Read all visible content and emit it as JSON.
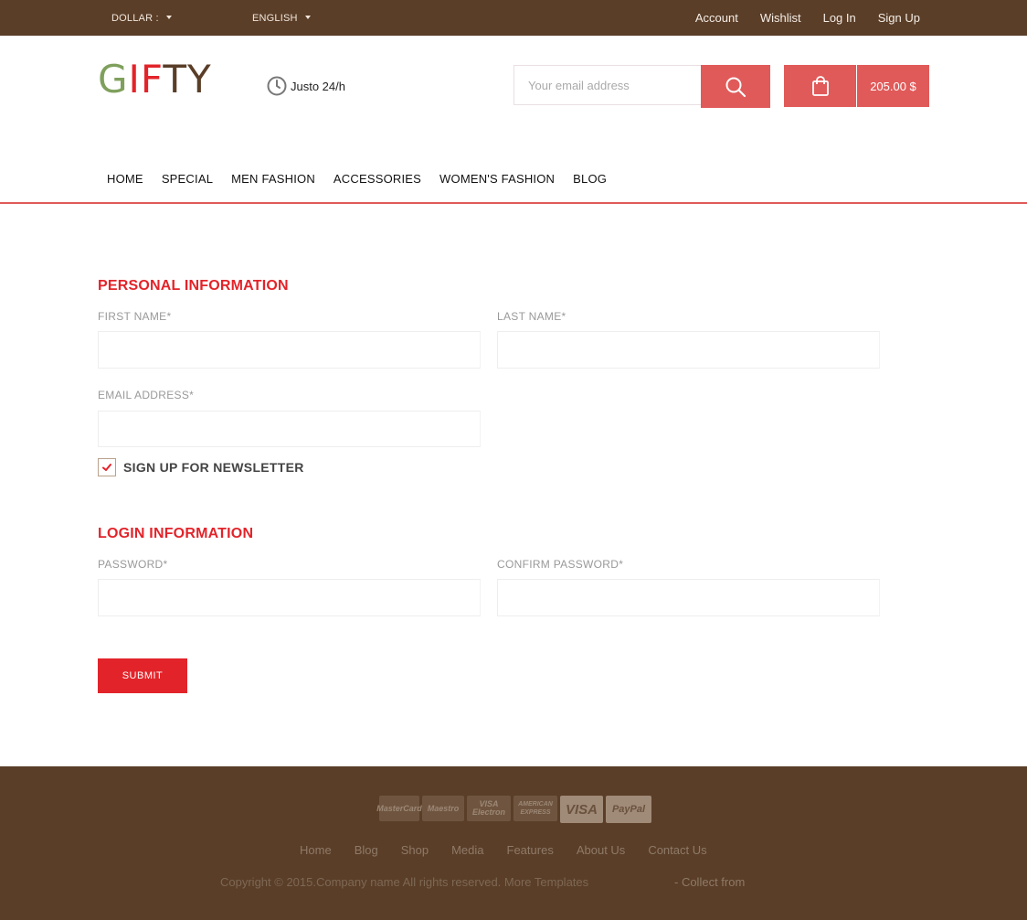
{
  "topbar": {
    "currency": "DOLLAR :",
    "language": "ENGLISH",
    "links": [
      "Account",
      "Wishlist",
      "Log In",
      "Sign Up"
    ]
  },
  "header": {
    "logo": {
      "g": "G",
      "if": "IF",
      "ty": "TY"
    },
    "hours": "Justo 24/h",
    "search_placeholder": "Your email address",
    "cart_total": "205.00 $"
  },
  "nav": [
    "HOME",
    "SPECIAL",
    "MEN FASHION",
    "ACCESSORIES",
    "WOMEN'S FASHION",
    "BLOG"
  ],
  "form": {
    "personal_title": "PERSONAL INFORMATION",
    "first_name": "FIRST NAME*",
    "last_name": "LAST NAME*",
    "email": "EMAIL ADDRESS*",
    "newsletter": "SIGN UP FOR NEWSLETTER",
    "login_title": "LOGIN INFORMATION",
    "password": "PASSWORD*",
    "confirm_password": "CONFIRM PASSWORD*",
    "submit": "SUBMIT"
  },
  "footer": {
    "cards": [
      "MasterCard",
      "Maestro",
      "VISA Electron",
      "AMERICAN EXPRESS",
      "VISA",
      "PayPal"
    ],
    "links": [
      "Home",
      "Blog",
      "Shop",
      "Media",
      "Features",
      "About Us",
      "Contact Us"
    ],
    "copyright": "Copyright © 2015.Company name All rights reserved. More Templates",
    "collect": "- Collect from"
  },
  "colors": {
    "brown": "#5a3e28",
    "accent_red": "#e2242a",
    "button_coral": "#e05a59",
    "logo_green": "#7fa05c"
  }
}
